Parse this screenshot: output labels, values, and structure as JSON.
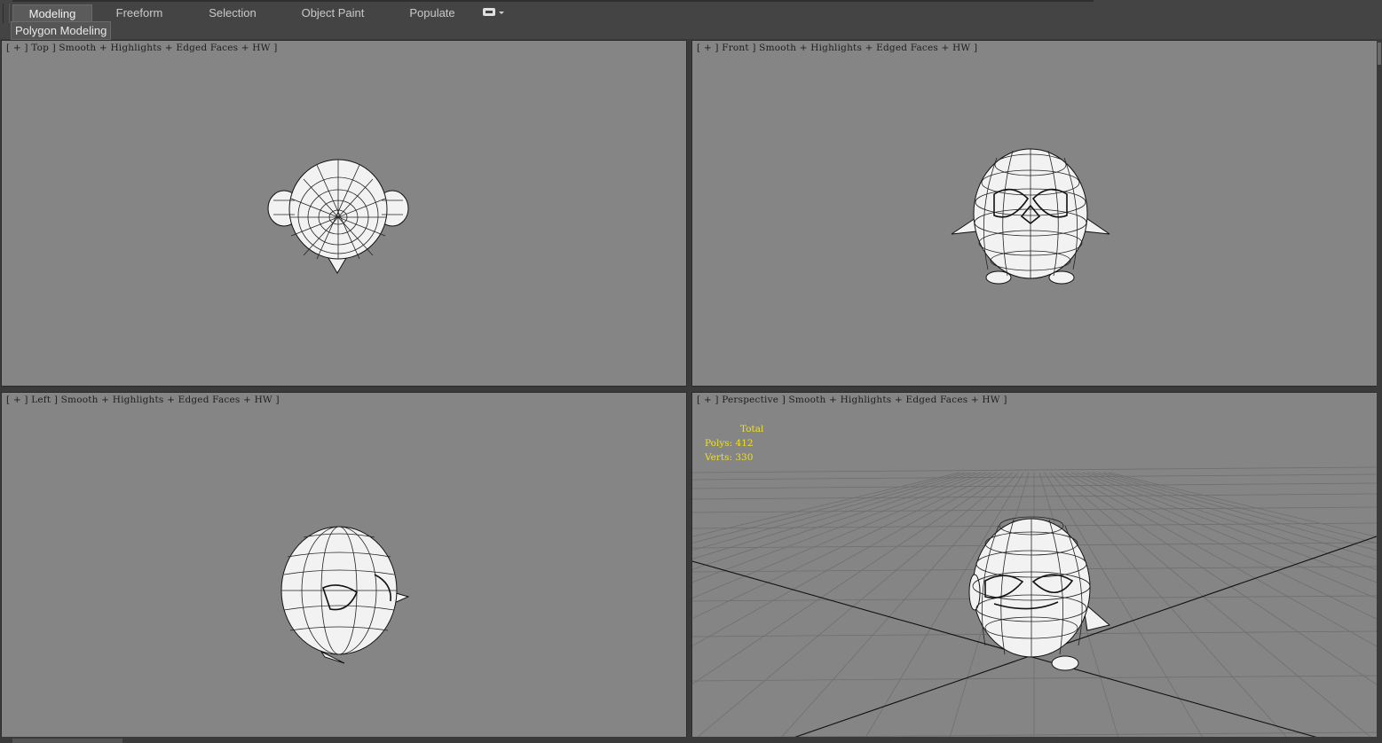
{
  "ribbon": {
    "tabs": [
      {
        "label": "Modeling",
        "active": true
      },
      {
        "label": "Freeform",
        "active": false
      },
      {
        "label": "Selection",
        "active": false
      },
      {
        "label": "Object Paint",
        "active": false
      },
      {
        "label": "Populate",
        "active": false
      }
    ],
    "extra_icon": "options-dropdown-icon",
    "subtab": "Polygon Modeling"
  },
  "viewports": {
    "top": {
      "label": "[ + ] Top ] Smooth + Highlights + Edged Faces + HW ]"
    },
    "front": {
      "label": "[ + ] Front ] Smooth + Highlights + Edged Faces + HW ]"
    },
    "left": {
      "label": "[ + ] Left ] Smooth + Highlights + Edged Faces + HW ]"
    },
    "perspective": {
      "label": "[ + ] Perspective ] Smooth + Highlights + Edged Faces + HW ]",
      "stats": {
        "title": "Total",
        "polys": "Polys: 412",
        "verts": "Verts: 330"
      }
    }
  },
  "colors": {
    "viewport_bg": "#858585",
    "stats_text": "#f0e020",
    "ui_bg": "#444444"
  }
}
